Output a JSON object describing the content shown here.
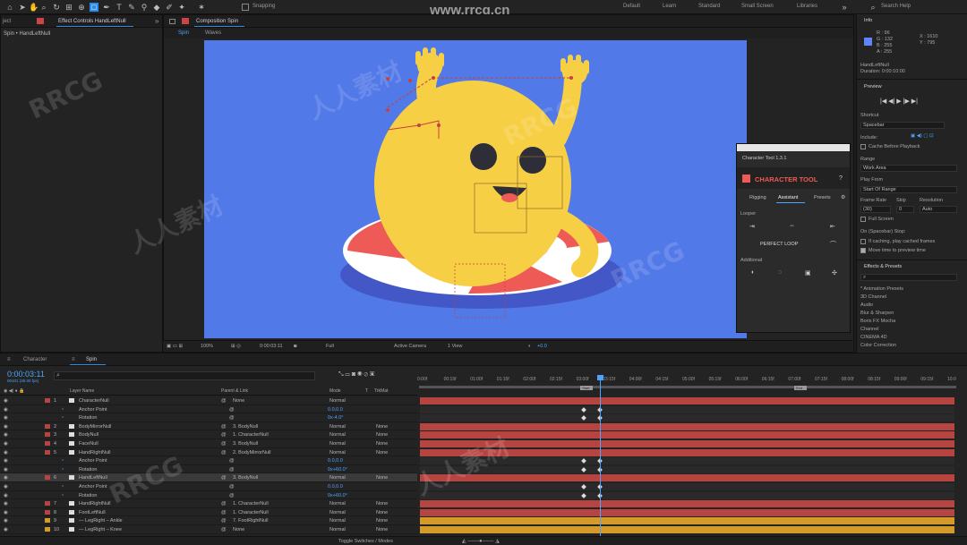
{
  "toolbar": {
    "snapping": "Snapping",
    "workspaces": [
      "Default",
      "Learn",
      "Standard",
      "Small Screen",
      "Libraries"
    ],
    "search_placeholder": "Search Help",
    "watermark_url": "www.rrcg.cn"
  },
  "left_panel": {
    "tab_project": "ject",
    "tab_effect": "Effect Controls HandLeftNull",
    "subtitle": "Spin • HandLeftNull"
  },
  "comp_panel": {
    "tab": "Composition Spin",
    "subtabs": [
      "Spin",
      "Waves"
    ]
  },
  "comp_footer": {
    "zoom": "100%",
    "time": "0:00:03:11",
    "resolution": "Full",
    "camera": "Active Camera",
    "view": "1 View",
    "exposure": "+0.0"
  },
  "character_tool": {
    "title": "Character Tool 1.3.1",
    "logo": "CHARACTER TOOL",
    "help": "?",
    "tabs": [
      "Rigging",
      "Assistant",
      "Presets"
    ],
    "looper_label": "Looper",
    "perfect_loop": "PERFECT LOOP",
    "additional_label": "Additional"
  },
  "info_panel": {
    "title": "Info",
    "r": "R : 96",
    "g": "G : 132",
    "b": "B : 255",
    "a": "A : 255",
    "x": "X : 1610",
    "y": "Y : 795",
    "layer": "HandLeftNull",
    "duration": "Duration: 0:00:10:00"
  },
  "preview_panel": {
    "title": "Preview",
    "shortcut_label": "Shortcut",
    "shortcut_value": "Spacebar",
    "include_label": "Include:",
    "cache_label": "Cache Before Playback",
    "range_label": "Range",
    "range_value": "Work Area",
    "play_from_label": "Play From",
    "play_from_value": "Start Of Range",
    "frame_rate_label": "Frame Rate",
    "skip_label": "Skip",
    "resolution_label": "Resolution",
    "frame_rate_value": "(30)",
    "skip_value": "0",
    "resolution_value": "Auto",
    "full_screen": "Full Screen",
    "stop_label": "On (Spacebar) Stop:",
    "if_caching": "If caching, play cached frames",
    "move_time": "Move time to preview time"
  },
  "effects_panel": {
    "title": "Effects & Presets",
    "search_placeholder": "",
    "items": [
      "* Animation Presets",
      "3D Channel",
      "Audio",
      "Blur & Sharpen",
      "Boris FX Mocha",
      "Channel",
      "CINEMA 4D",
      "Color Correction"
    ]
  },
  "timeline": {
    "tab_character": "Character",
    "tab_spin": "Spin",
    "current_time": "0:00:03:11",
    "frame_info": "00101 (30.00 fps)",
    "col_layer_name": "Layer Name",
    "col_parent": "Parent & Link",
    "col_mode": "Mode",
    "col_trkmat": "TrkMat",
    "col_t": "T",
    "footer": "Toggle Switches / Modes",
    "ruler": [
      "0:00f",
      "00:15f",
      "01:00f",
      "01:15f",
      "02:00f",
      "02:15f",
      "03:00f",
      "03:15f",
      "04:00f",
      "04:15f",
      "05:00f",
      "05:15f",
      "06:00f",
      "06:15f",
      "07:00f",
      "07:15f",
      "08:00f",
      "08:15f",
      "09:00f",
      "09:15f",
      "10:0"
    ],
    "marker_start": "Start",
    "marker_end": "End",
    "rows": [
      {
        "num": "1",
        "name": "CharacterNull",
        "parent": "None",
        "mode": "Normal",
        "trk": "",
        "color": "#b64440",
        "type": "layer"
      },
      {
        "num": "",
        "name": "Anchor Point",
        "parent": "",
        "mode": "",
        "value": "0.0,0.0",
        "type": "prop"
      },
      {
        "num": "",
        "name": "Rotation",
        "parent": "",
        "mode": "",
        "value": "0x-4.0°",
        "type": "prop"
      },
      {
        "num": "2",
        "name": "BodyMirrorNull",
        "parent": "3. BodyNull",
        "mode": "Normal",
        "trk": "None",
        "color": "#b64440",
        "type": "layer"
      },
      {
        "num": "3",
        "name": "BodyNull",
        "parent": "1. CharacterNull",
        "mode": "Normal",
        "trk": "None",
        "color": "#b64440",
        "type": "layer"
      },
      {
        "num": "4",
        "name": "FaceNull",
        "parent": "3. BodyNull",
        "mode": "Normal",
        "trk": "None",
        "color": "#b64440",
        "type": "layer"
      },
      {
        "num": "5",
        "name": "HandRightNull",
        "parent": "2. BodyMirrorNull",
        "mode": "Normal",
        "trk": "None",
        "color": "#b64440",
        "type": "layer"
      },
      {
        "num": "",
        "name": "Anchor Point",
        "parent": "",
        "mode": "",
        "value": "0.0,0.0",
        "type": "prop"
      },
      {
        "num": "",
        "name": "Rotation",
        "parent": "",
        "mode": "",
        "value": "0x+60.0°",
        "type": "prop"
      },
      {
        "num": "6",
        "name": "HandLeftNull",
        "parent": "3. BodyNull",
        "mode": "Normal",
        "trk": "None",
        "color": "#b64440",
        "type": "layer",
        "selected": true
      },
      {
        "num": "",
        "name": "Anchor Point",
        "parent": "",
        "mode": "",
        "value": "0.0,0.0",
        "type": "prop"
      },
      {
        "num": "",
        "name": "Rotation",
        "parent": "",
        "mode": "",
        "value": "0x+60.0°",
        "type": "prop"
      },
      {
        "num": "7",
        "name": "HandRightNull",
        "parent": "1. CharacterNull",
        "mode": "Normal",
        "trk": "None",
        "color": "#b64440",
        "type": "layer"
      },
      {
        "num": "8",
        "name": "FootLeftNull",
        "parent": "1. CharacterNull",
        "mode": "Normal",
        "trk": "None",
        "color": "#b64440",
        "type": "layer"
      },
      {
        "num": "9",
        "name": "— LegRight – Ankle",
        "parent": "7. FootRightNull",
        "mode": "Normal",
        "trk": "None",
        "color": "#d49a2a",
        "type": "layer"
      },
      {
        "num": "10",
        "name": "— LegRight – Knee",
        "parent": "None",
        "mode": "Normal",
        "trk": "None",
        "color": "#d49a2a",
        "type": "layer"
      }
    ]
  }
}
